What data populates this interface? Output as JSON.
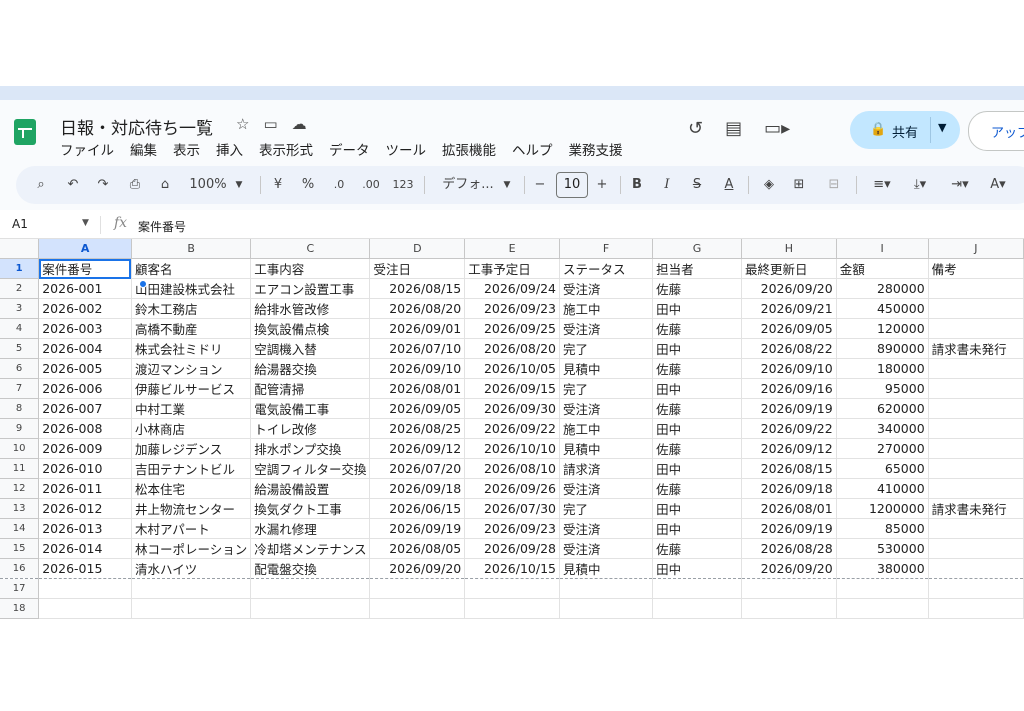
{
  "app": {
    "title": "日報・対応待ち一覧",
    "menus": [
      "ファイル",
      "編集",
      "表示",
      "挿入",
      "表示形式",
      "データ",
      "ツール",
      "拡張機能",
      "ヘルプ",
      "業務支援"
    ],
    "share_label": "共有",
    "upgrade_label": "アップ",
    "colors": {
      "accent": "#1a73e8",
      "share_bg": "#c2e7ff",
      "logo": "#1fa463"
    }
  },
  "toolbar": {
    "zoom": "100%",
    "currency": "¥",
    "percent": "%",
    "dec_decrease": ".0",
    "dec_increase": ".00",
    "format_123": "123",
    "font": "デフォ...",
    "font_size": "10",
    "bold": "B",
    "italic": "I",
    "strike": "S",
    "textcolor": "A"
  },
  "formula_bar": {
    "cell_ref": "A1",
    "fx": "fx",
    "value": "案件番号"
  },
  "grid": {
    "columns": [
      "A",
      "B",
      "C",
      "D",
      "E",
      "F",
      "G",
      "H",
      "I",
      "J"
    ],
    "row_numbers": [
      "1",
      "2",
      "3",
      "4",
      "5",
      "6",
      "7",
      "8",
      "9",
      "10",
      "11",
      "12",
      "13",
      "14",
      "15",
      "16",
      "17",
      "18"
    ],
    "rows": [
      [
        "案件番号",
        "顧客名",
        "工事内容",
        "受注日",
        "工事予定日",
        "ステータス",
        "担当者",
        "最終更新日",
        "金額",
        "備考"
      ],
      [
        "2026-001",
        "山田建設株式会社",
        "エアコン設置工事",
        "2026/08/15",
        "2026/09/24",
        "受注済",
        "佐藤",
        "2026/09/20",
        "280000",
        ""
      ],
      [
        "2026-002",
        "鈴木工務店",
        "給排水管改修",
        "2026/08/20",
        "2026/09/23",
        "施工中",
        "田中",
        "2026/09/21",
        "450000",
        ""
      ],
      [
        "2026-003",
        "高橋不動産",
        "換気設備点検",
        "2026/09/01",
        "2026/09/25",
        "受注済",
        "佐藤",
        "2026/09/05",
        "120000",
        ""
      ],
      [
        "2026-004",
        "株式会社ミドリ",
        "空調機入替",
        "2026/07/10",
        "2026/08/20",
        "完了",
        "田中",
        "2026/08/22",
        "890000",
        "請求書未発行"
      ],
      [
        "2026-005",
        "渡辺マンション",
        "給湯器交換",
        "2026/09/10",
        "2026/10/05",
        "見積中",
        "佐藤",
        "2026/09/10",
        "180000",
        ""
      ],
      [
        "2026-006",
        "伊藤ビルサービス",
        "配管清掃",
        "2026/08/01",
        "2026/09/15",
        "完了",
        "田中",
        "2026/09/16",
        "95000",
        ""
      ],
      [
        "2026-007",
        "中村工業",
        "電気設備工事",
        "2026/09/05",
        "2026/09/30",
        "受注済",
        "佐藤",
        "2026/09/19",
        "620000",
        ""
      ],
      [
        "2026-008",
        "小林商店",
        "トイレ改修",
        "2026/08/25",
        "2026/09/22",
        "施工中",
        "田中",
        "2026/09/22",
        "340000",
        ""
      ],
      [
        "2026-009",
        "加藤レジデンス",
        "排水ポンプ交換",
        "2026/09/12",
        "2026/10/10",
        "見積中",
        "佐藤",
        "2026/09/12",
        "270000",
        ""
      ],
      [
        "2026-010",
        "吉田テナントビル",
        "空調フィルター交換",
        "2026/07/20",
        "2026/08/10",
        "請求済",
        "田中",
        "2026/08/15",
        "65000",
        ""
      ],
      [
        "2026-011",
        "松本住宅",
        "給湯設備設置",
        "2026/09/18",
        "2026/09/26",
        "受注済",
        "佐藤",
        "2026/09/18",
        "410000",
        ""
      ],
      [
        "2026-012",
        "井上物流センター",
        "換気ダクト工事",
        "2026/06/15",
        "2026/07/30",
        "完了",
        "田中",
        "2026/08/01",
        "1200000",
        "請求書未発行"
      ],
      [
        "2026-013",
        "木村アパート",
        "水漏れ修理",
        "2026/09/19",
        "2026/09/23",
        "受注済",
        "田中",
        "2026/09/19",
        "85000",
        ""
      ],
      [
        "2026-014",
        "林コーポレーション",
        "冷却塔メンテナンス",
        "2026/08/05",
        "2026/09/28",
        "受注済",
        "佐藤",
        "2026/08/28",
        "530000",
        ""
      ],
      [
        "2026-015",
        "清水ハイツ",
        "配電盤交換",
        "2026/09/20",
        "2026/10/15",
        "見積中",
        "田中",
        "2026/09/20",
        "380000",
        ""
      ]
    ]
  }
}
